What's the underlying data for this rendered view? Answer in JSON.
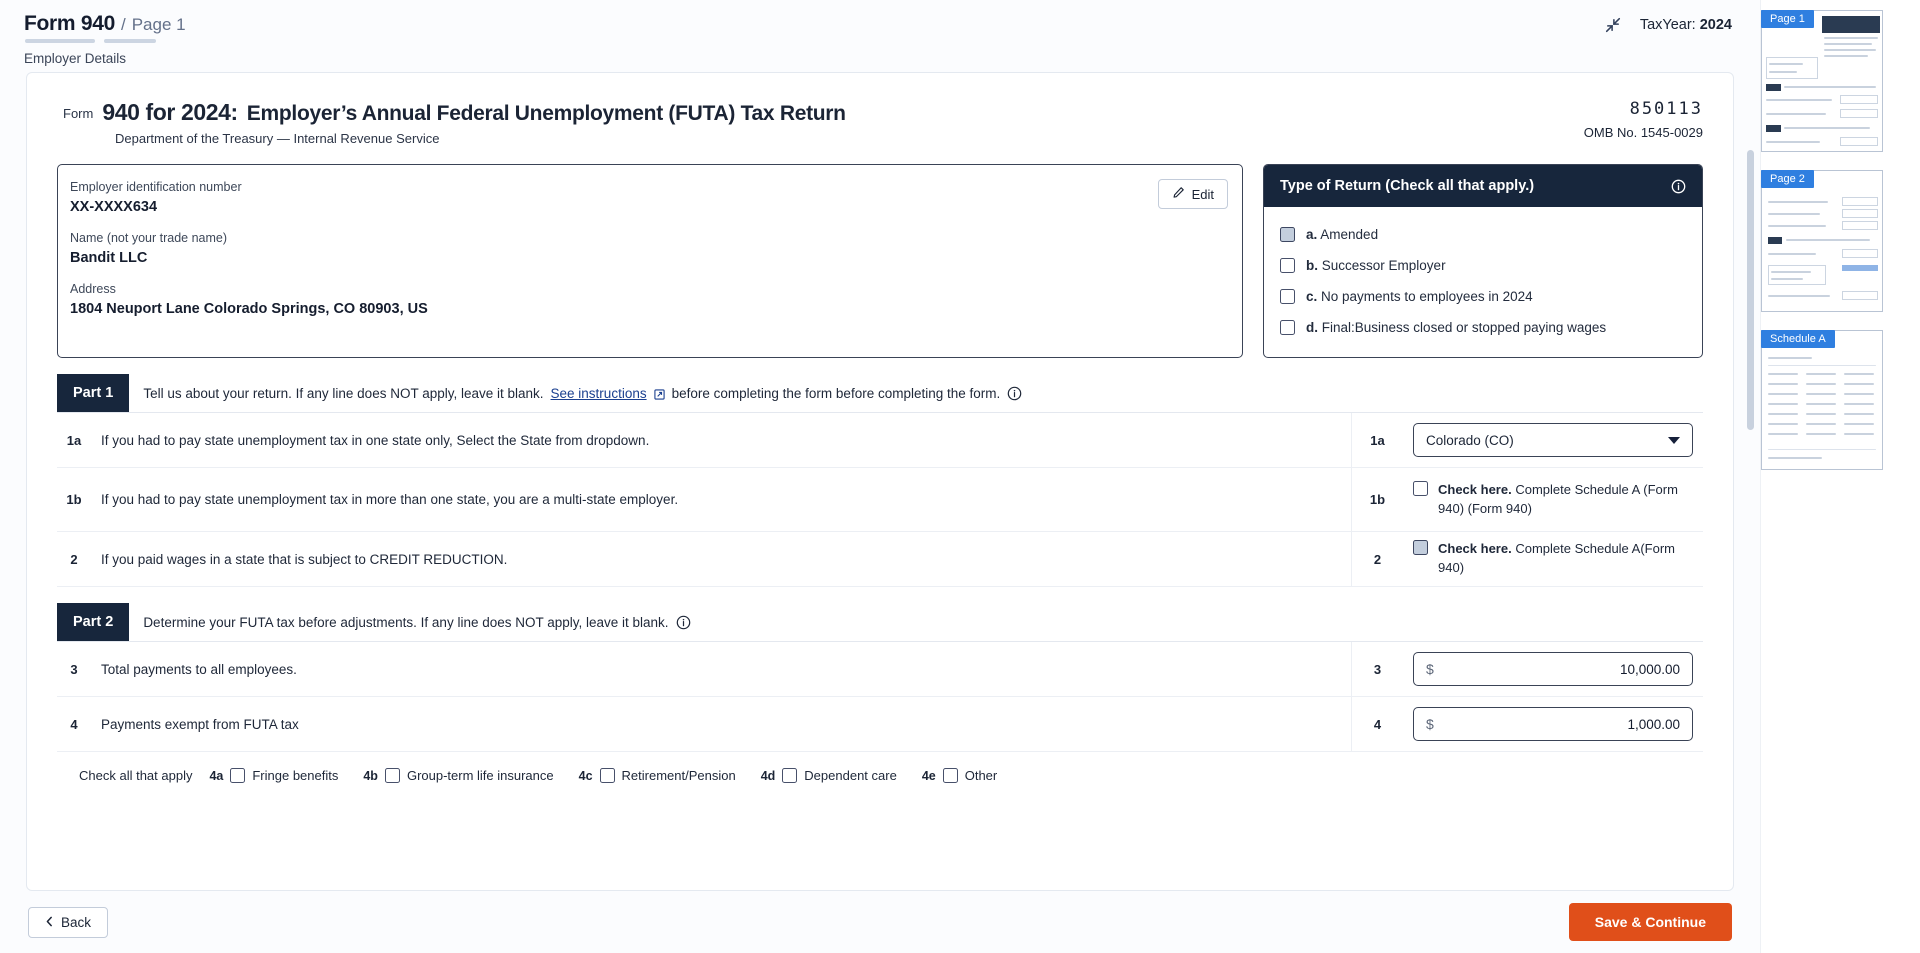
{
  "header": {
    "form_name": "Form 940",
    "separator": "/",
    "page_label": "Page 1",
    "sub_crumb": "Employer Details",
    "collapse_icon": "collapse-icon",
    "taxyear_label": "TaxYear:",
    "taxyear_value": "2024"
  },
  "form": {
    "form_word": "Form",
    "number_line": "940 for 2024:",
    "title": "Employer’s Annual Federal Unemployment (FUTA) Tax Return",
    "subtitle": "Department of the Treasury — Internal Revenue Service",
    "ocr_code": "850113",
    "omb": "OMB No. 1545-0029"
  },
  "employer": {
    "edit_label": "Edit",
    "edit_icon": "pencil-icon",
    "fields": [
      {
        "label": "Employer identification number",
        "value": "XX-XXXX634"
      },
      {
        "label": "Name (not your trade name)",
        "value": "Bandit LLC"
      },
      {
        "label": "Address",
        "value": "1804 Neuport Lane Colorado Springs, CO 80903, US"
      }
    ]
  },
  "type_of_return": {
    "heading": "Type of Return (Check all that apply.)",
    "info_icon": "info-icon",
    "options": [
      {
        "key": "a.",
        "label": "Amended",
        "checked": false,
        "focused": true
      },
      {
        "key": "b.",
        "label": "Successor Employer",
        "checked": false,
        "focused": false
      },
      {
        "key": "c.",
        "label": "No payments to employees in 2024",
        "checked": false,
        "focused": false
      },
      {
        "key": "d.",
        "label": "Final:Business closed or stopped paying wages",
        "checked": false,
        "focused": false
      }
    ]
  },
  "part1": {
    "tag": "Part 1",
    "text_before": "Tell us about your return. If any line does NOT apply, leave it blank.",
    "link_text": "See instructions",
    "link_icon": "external-link-icon",
    "text_after": "before completing the form before completing the form.",
    "info_icon": "info-icon",
    "lines": [
      {
        "no": "1a",
        "text": "If you had to pay state unemployment tax in one state only, Select the State from dropdown.",
        "right_no": "1a",
        "control": "select",
        "value": "Colorado (CO)"
      },
      {
        "no": "1b",
        "text": "If you had to pay state unemployment tax in more than one state, you are a multi-state employer.",
        "right_no": "1b",
        "control": "checkbox",
        "strong": "Check here.",
        "rest": "Complete Schedule A (Form 940) (Form 940)",
        "focused": false
      },
      {
        "no": "2",
        "text": "If you paid wages in a state that is subject to CREDIT REDUCTION.",
        "right_no": "2",
        "control": "checkbox",
        "strong": "Check here.",
        "rest": "Complete Schedule A(Form 940)",
        "focused": true
      }
    ]
  },
  "part2": {
    "tag": "Part 2",
    "text": "Determine your FUTA tax before adjustments. If any line does NOT apply, leave it blank.",
    "info_icon": "info-icon",
    "lines": [
      {
        "no": "3",
        "text": "Total payments to all employees.",
        "right_no": "3",
        "currency": "$",
        "value": "10,000.00"
      },
      {
        "no": "4",
        "text": "Payments exempt from FUTA tax",
        "right_no": "4",
        "currency": "$",
        "value": "1,000.00"
      }
    ],
    "check_all_label": "Check all that apply",
    "check_all": [
      {
        "key": "4a",
        "label": "Fringe benefits",
        "checked": false
      },
      {
        "key": "4b",
        "label": "Group-term life insurance",
        "checked": false
      },
      {
        "key": "4c",
        "label": "Retirement/Pension",
        "checked": false
      },
      {
        "key": "4d",
        "label": "Dependent care",
        "checked": false
      },
      {
        "key": "4e",
        "label": "Other",
        "checked": false
      }
    ]
  },
  "footer": {
    "back_label": "Back",
    "back_icon": "chevron-left-icon",
    "save_label": "Save & Continue"
  },
  "thumbnails": [
    {
      "label": "Page 1"
    },
    {
      "label": "Page 2"
    },
    {
      "label": "Schedule A"
    }
  ],
  "colors": {
    "accent_orange": "#e04f1a",
    "dark_navy": "#17263c",
    "thumb_blue": "#2f7fe0",
    "link_blue": "#1a3f8f"
  }
}
